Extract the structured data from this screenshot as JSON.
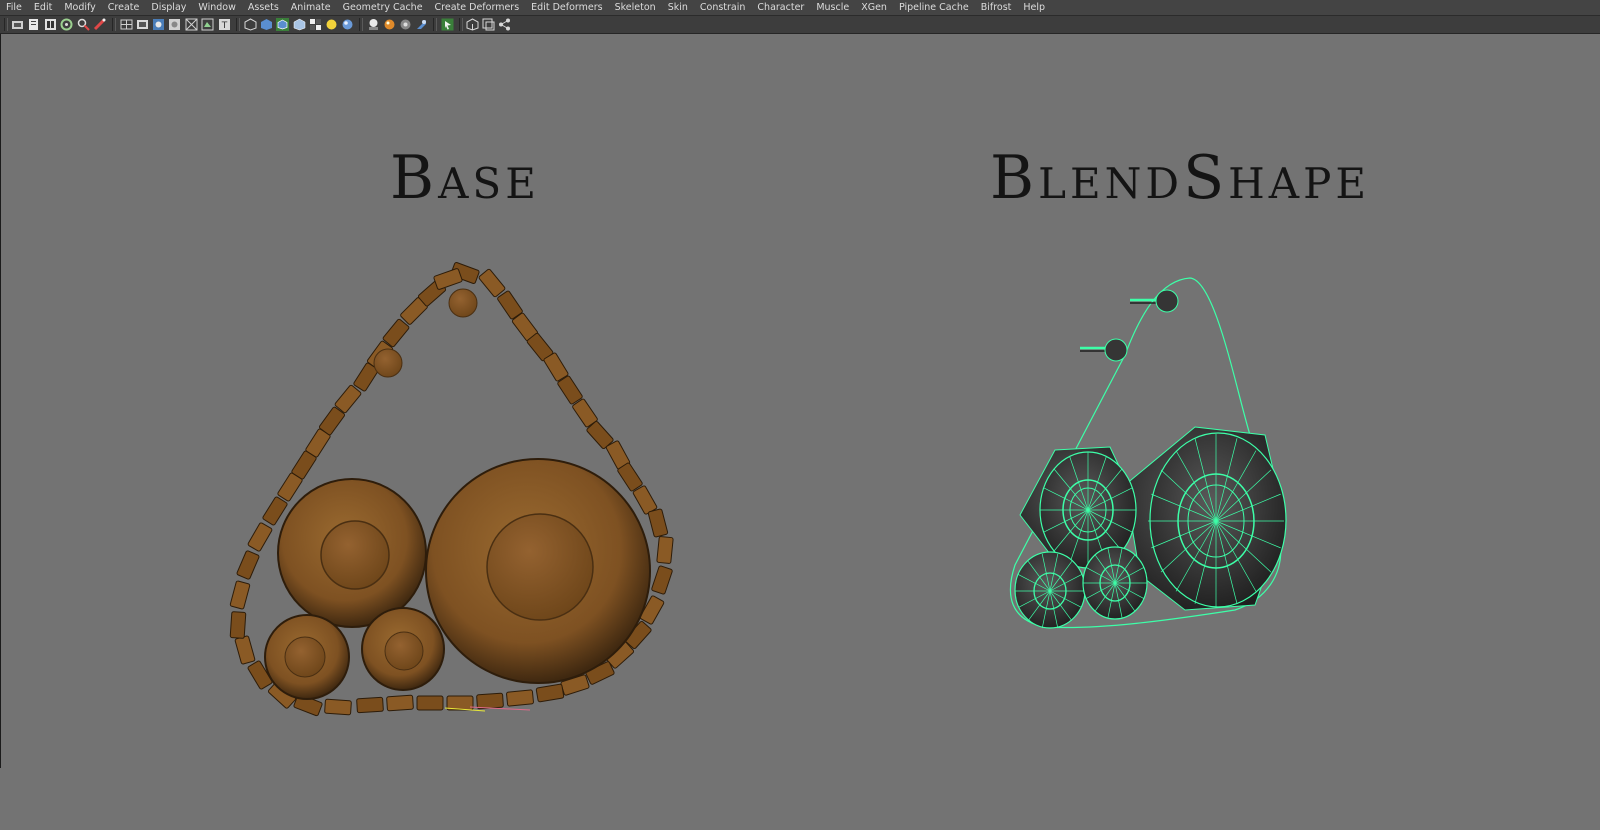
{
  "menubar": {
    "items": [
      "File",
      "Edit",
      "Modify",
      "Create",
      "Display",
      "Window",
      "Assets",
      "Animate",
      "Geometry Cache",
      "Create Deformers",
      "Edit Deformers",
      "Skeleton",
      "Skin",
      "Constrain",
      "Character",
      "Muscle",
      "XGen",
      "Pipeline Cache",
      "Bifrost",
      "Help"
    ]
  },
  "toolbar": {
    "icons": [
      "select-tool-icon",
      "lasso-icon",
      "paint-select-icon",
      "move-icon",
      "rotate-icon",
      "scale-icon",
      "grid-icon",
      "film-gate-icon",
      "resolution-gate-icon",
      "camera-icon",
      "image-plane-icon",
      "isolate-icon",
      "xray-icon",
      "wireframe-icon",
      "smooth-shade-icon",
      "wireframe-on-shaded-icon",
      "textured-icon",
      "lights-icon",
      "shadows-icon",
      "ambient-occlusion-icon",
      "motion-blur-icon",
      "antialias-icon",
      "depth-of-field-icon",
      "highlight-icon",
      "panel-layout-icon",
      "two-panes-icon",
      "node-editor-icon"
    ]
  },
  "viewport": {
    "background": "#737373",
    "left_label": "Base",
    "right_label": "BlendShape",
    "base_color": "#8a5a25",
    "wireframe_color": "#3dffa8"
  }
}
